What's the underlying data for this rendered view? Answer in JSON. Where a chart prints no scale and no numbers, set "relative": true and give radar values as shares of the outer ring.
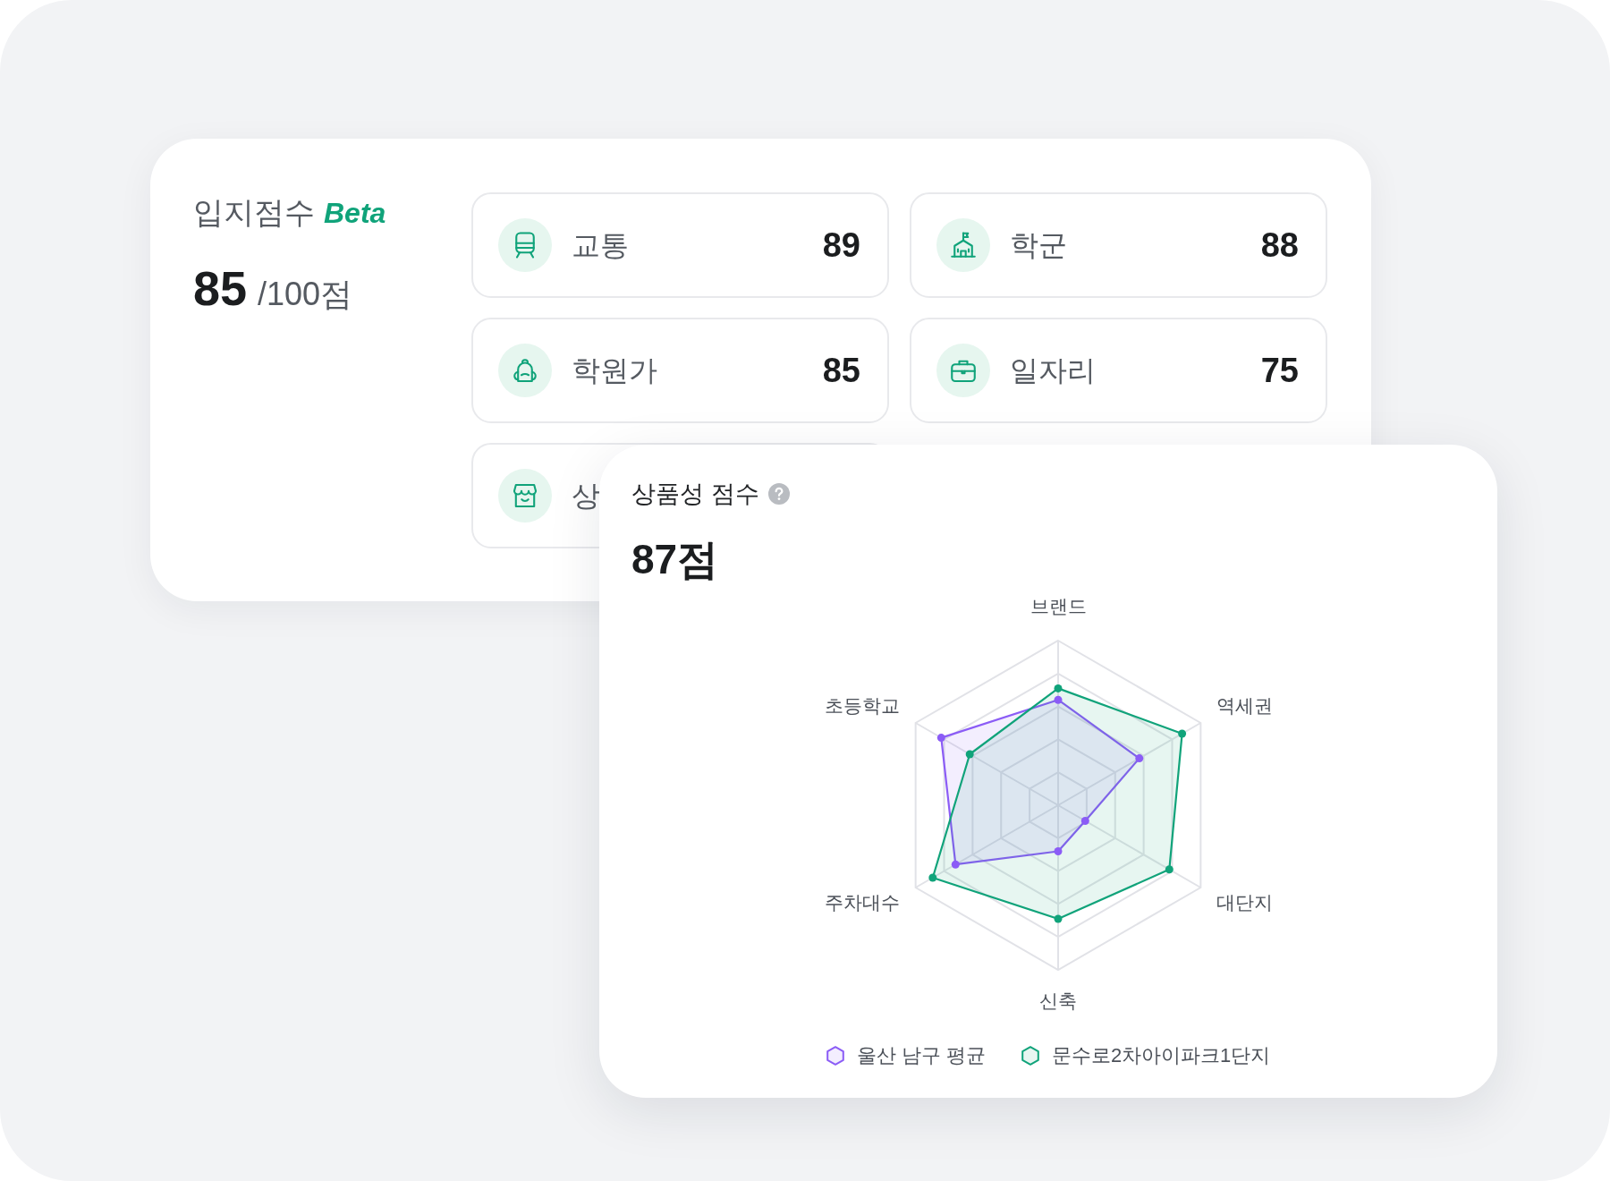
{
  "location_score": {
    "title": "입지점수",
    "badge": "Beta",
    "score": "85",
    "total": "/100점",
    "categories": [
      {
        "label": "교통",
        "score": "89"
      },
      {
        "label": "학군",
        "score": "88"
      },
      {
        "label": "학원가",
        "score": "85"
      },
      {
        "label": "일자리",
        "score": "75"
      },
      {
        "label": "상"
      }
    ]
  },
  "product_score": {
    "title": "상품성 점수",
    "score": "87점",
    "chart_data": {
      "type": "radar",
      "relative": true,
      "categories": [
        "브랜드",
        "역세권",
        "대단지",
        "신축",
        "주차대수",
        "초등학교"
      ],
      "series": [
        {
          "name": "울산 남구 평균",
          "color": "#8b5cf6",
          "values": [
            0.64,
            0.57,
            0.19,
            0.28,
            0.72,
            0.82
          ]
        },
        {
          "name": "문수로2차아이파크1단지",
          "color": "#10a37a",
          "values": [
            0.71,
            0.87,
            0.78,
            0.69,
            0.88,
            0.62
          ]
        }
      ]
    }
  }
}
